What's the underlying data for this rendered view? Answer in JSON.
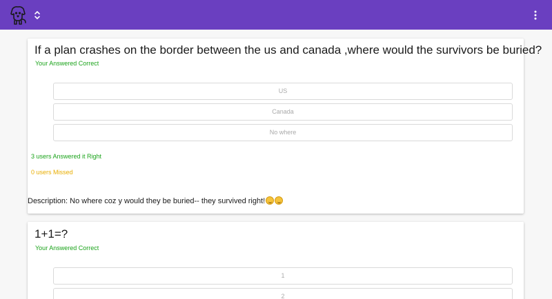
{
  "app": {
    "logo_icon": "dog-icon",
    "switch_icon": "chevron-up-down-icon",
    "menu_icon": "more-vertical-icon",
    "header_color": "#6a3fc0"
  },
  "questions": [
    {
      "question": "If a plan crashes on the border between the us and canada ,where would the survivors be buried?",
      "result": "Your Answered Correct",
      "options": [
        "US",
        "Canada",
        "No where"
      ],
      "right_stat": "3 users Answered it Right",
      "missed_stat": "0 users Missed",
      "description": "Description: No where coz y would they be buried-- they survived right!"
    },
    {
      "question": "1+1=?",
      "result": "Your Answered Correct",
      "options": [
        "1",
        "2"
      ]
    }
  ],
  "colors": {
    "correct": "#1aa31a",
    "missed": "#e8ad00"
  }
}
